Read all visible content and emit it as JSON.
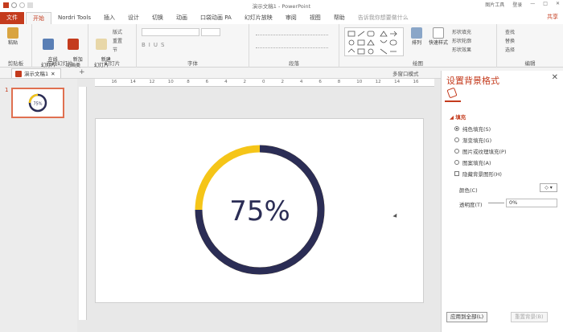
{
  "window": {
    "title": "演示文稿1 - PowerPoint",
    "right_items": [
      "图片工具",
      "登录"
    ]
  },
  "ribbon_tabs": [
    "文件",
    "开始",
    "Nordri Tools",
    "插入",
    "设计",
    "切换",
    "动画",
    "口袋动画 PA",
    "幻灯片放映",
    "审阅",
    "视图",
    "帮助"
  ],
  "tell_me": "告诉我你想要做什么",
  "login": "共享",
  "ribbon": {
    "clipboard": {
      "paste": "粘贴",
      "label": "剪贴板"
    },
    "online": {
      "btn1": "在线\n幻灯片",
      "btn2": "新加\n动画类",
      "label": "在线幻灯片"
    },
    "slides": {
      "new": "新建\n幻灯片",
      "layout": "版式",
      "reset": "重置",
      "section": "节",
      "label": "幻灯片"
    },
    "font": {
      "label": "字体"
    },
    "paragraph": {
      "label": "段落"
    },
    "drawing": {
      "arrange": "排列",
      "quick": "快速样式",
      "fill": "形状填充",
      "outline": "形状轮廓",
      "effects": "形状效果",
      "label": "绘图"
    },
    "editing": {
      "find": "查找",
      "replace": "替换",
      "select": "选择",
      "label": "编辑"
    }
  },
  "doc_tab": "演示文稿1",
  "view_mode": "多窗口模式",
  "slide_number": "1",
  "ruler_labels": [
    "16",
    "14",
    "12",
    "10",
    "8",
    "6",
    "4",
    "2",
    "0",
    "2",
    "4",
    "6",
    "8",
    "10",
    "12",
    "14",
    "16"
  ],
  "chart_data": {
    "type": "pie",
    "center_label": "75%",
    "value": 75,
    "colors": {
      "value": "#2b2d55",
      "remainder": "#f5c518"
    }
  },
  "thumb_label": "75%",
  "pane": {
    "title": "设置背景格式",
    "section": "填充",
    "options": [
      {
        "label": "纯色填充(S)",
        "selected": true
      },
      {
        "label": "渐变填充(G)",
        "selected": false
      },
      {
        "label": "图片或纹理填充(P)",
        "selected": false
      },
      {
        "label": "图案填充(A)",
        "selected": false
      }
    ],
    "hide_bg": "隐藏背景图形(H)",
    "color_label": "颜色(C)",
    "transparency_label": "透明度(T)",
    "transparency_value": "0%",
    "apply_all": "应用到全部(L)",
    "reset_bg": "重置背景(B)"
  }
}
